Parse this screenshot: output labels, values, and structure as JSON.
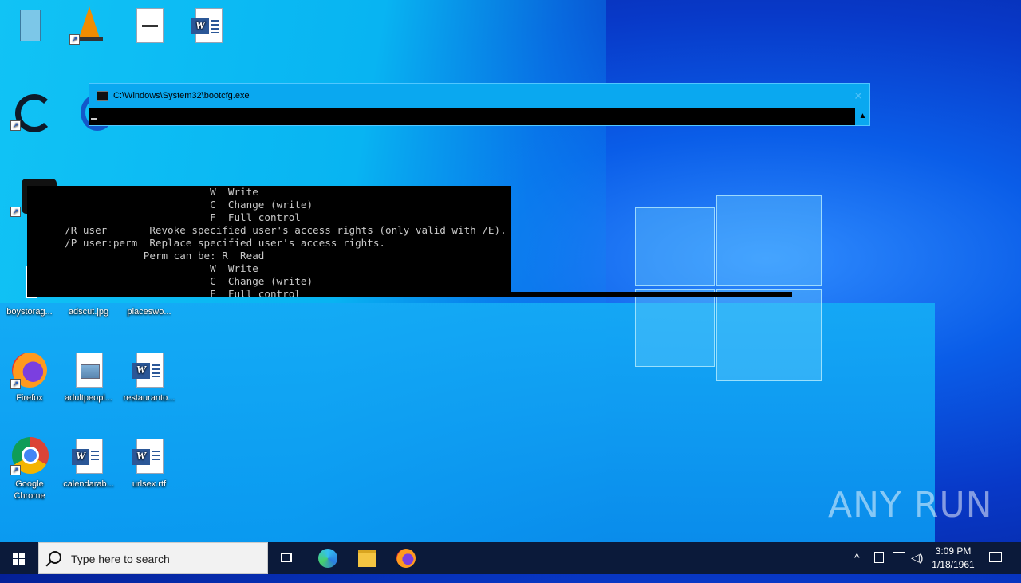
{
  "desktop": {
    "icons": [
      {
        "label": ""
      },
      {
        "label": ""
      },
      {
        "label": ""
      },
      {
        "label": ""
      },
      {
        "label": "boystorag..."
      },
      {
        "label": "adscut.jpg"
      },
      {
        "label": "placeswo..."
      },
      {
        "label": "Firefox"
      },
      {
        "label": "adultpeopl..."
      },
      {
        "label": "restauranto..."
      },
      {
        "label": "Google Chrome"
      },
      {
        "label": "calendarab..."
      },
      {
        "label": "urlsex.rtf"
      }
    ]
  },
  "bootcfg_window": {
    "title": "C:\\Windows\\System32\\bootcfg.exe"
  },
  "console_fragment": {
    "lines": [
      "                          W  Write",
      "                          C  Change (write)",
      "                          F  Full control",
      "  /R user       Revoke specified user's access rights (only valid with /E).",
      "  /P user:perm  Replace specified user's access rights.",
      "               Perm can be: R  Read",
      "                          W  Write",
      "                          C  Change (write)",
      "                          F  Full control"
    ]
  },
  "watermark": "ANY RUN",
  "taskbar": {
    "search_placeholder": "Type here to search",
    "time": "3:09 PM",
    "date": "1/18/1961"
  },
  "colors": {
    "taskbar_bg": "#0b1a3a",
    "console_bg": "#000000",
    "window_title_bg": "#0aa8f0"
  }
}
